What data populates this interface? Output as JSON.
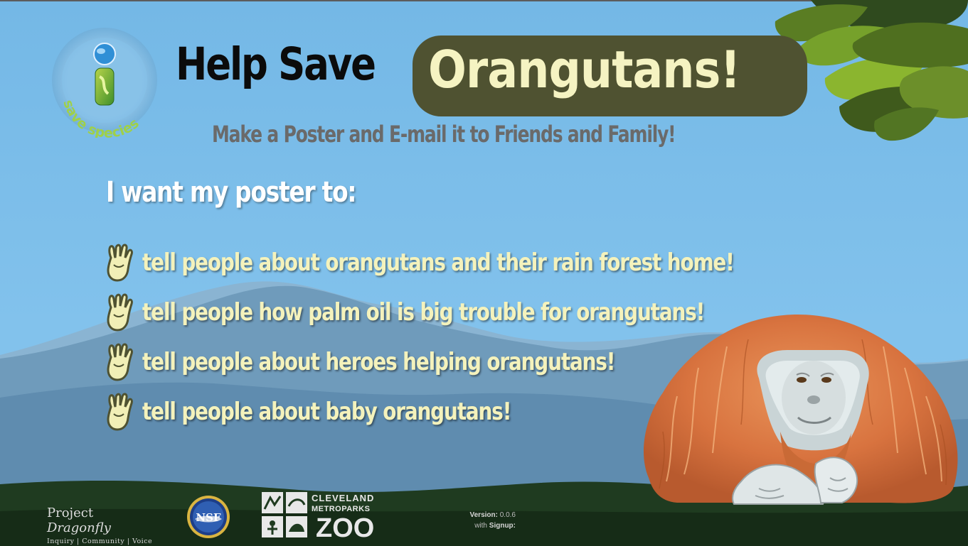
{
  "app": {
    "logo_text": "save species",
    "title_plain": "Help Save",
    "title_accent": "Orangutans!",
    "subtitle": "Make a Poster and E-mail it to Friends and Family!",
    "prompt": "I want my poster to:"
  },
  "options": [
    {
      "label": "tell people about orangutans and their rain forest home!"
    },
    {
      "label": "tell people how palm oil is big trouble for orangutans!"
    },
    {
      "label": "tell people about heroes helping orangutans!"
    },
    {
      "label": "tell people about baby orangutans!"
    }
  ],
  "footer": {
    "dragonfly_name_1": "Project",
    "dragonfly_name_2": "Dragonfly",
    "dragonfly_tagline": "Inquiry | Community | Voice",
    "nsf_text": "NSF",
    "zoo_line1": "CLEVELAND",
    "zoo_line2": "METROPARKS",
    "zoo_line3": "ZOO",
    "version_label": "Version:",
    "version_value": "0.0.6",
    "signup_prefix": "with",
    "signup_label": "Signup:"
  },
  "colors": {
    "sky": "#7cbde8",
    "title_accent_bg": "#4f5231",
    "title_accent_text": "#f5f3c2",
    "option_text": "#f4f2bc",
    "ground": "#1e3a1e"
  },
  "icons": {
    "logo": "info-i-globe-logo",
    "option_bullet": "paw-print-icon",
    "foliage": "leaves-decoration",
    "animal": "orangutan-illustration"
  }
}
